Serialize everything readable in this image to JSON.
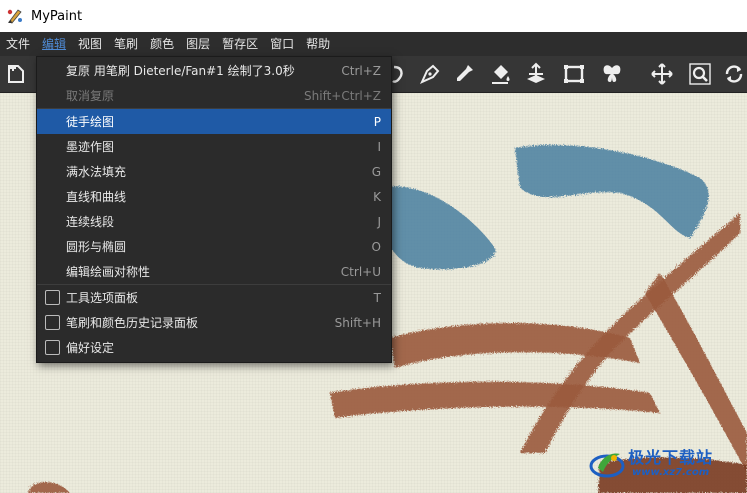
{
  "window": {
    "title": "MyPaint"
  },
  "menubar": {
    "items": [
      {
        "label": "文件"
      },
      {
        "label": "编辑"
      },
      {
        "label": "视图"
      },
      {
        "label": "笔刷"
      },
      {
        "label": "颜色"
      },
      {
        "label": "图层"
      },
      {
        "label": "暂存区"
      },
      {
        "label": "窗口"
      },
      {
        "label": "帮助"
      }
    ],
    "active": "编辑"
  },
  "toolbar": {
    "left_icon": "new-document-icon",
    "icons": [
      "lasso-icon",
      "ink-pen-icon",
      "eyedropper-icon",
      "fill-bucket-icon",
      "move-layer-icon",
      "frame-icon",
      "symmetry-icon",
      "pan-icon",
      "zoom-icon",
      "rotate-icon"
    ]
  },
  "edit_menu": {
    "items": [
      {
        "label": "复原 用笔刷 Dieterle/Fan#1 绘制了3.0秒",
        "shortcut": "Ctrl+Z",
        "enabled": true
      },
      {
        "label": "取消复原",
        "shortcut": "Shift+Ctrl+Z",
        "enabled": false
      },
      {
        "label": "徒手绘图",
        "shortcut": "P",
        "highlighted": true
      },
      {
        "label": "墨迹作图",
        "shortcut": "I"
      },
      {
        "label": "满水法填充",
        "shortcut": "G"
      },
      {
        "label": "直线和曲线",
        "shortcut": "K"
      },
      {
        "label": "连续线段",
        "shortcut": "J"
      },
      {
        "label": "圆形与椭圆",
        "shortcut": "O"
      },
      {
        "label": "编辑绘画对称性",
        "shortcut": "Ctrl+U"
      },
      {
        "label": "工具选项面板",
        "shortcut": "T",
        "checkbox": true,
        "checked": false
      },
      {
        "label": "笔刷和颜色历史记录面板",
        "shortcut": "Shift+H",
        "checkbox": true,
        "checked": false
      },
      {
        "label": "偏好设定",
        "shortcut": "",
        "checkbox": true,
        "checked": false
      }
    ]
  },
  "colors": {
    "menubar_bg": "#2d2d2d",
    "highlight": "#1f5aa6",
    "canvas_bg": "#ecebdc",
    "blue_paint": "#4a7fa0",
    "brown_paint": "#9b5a3c"
  },
  "watermark": {
    "text": "极光下载站",
    "url": "www.xz7.com"
  }
}
